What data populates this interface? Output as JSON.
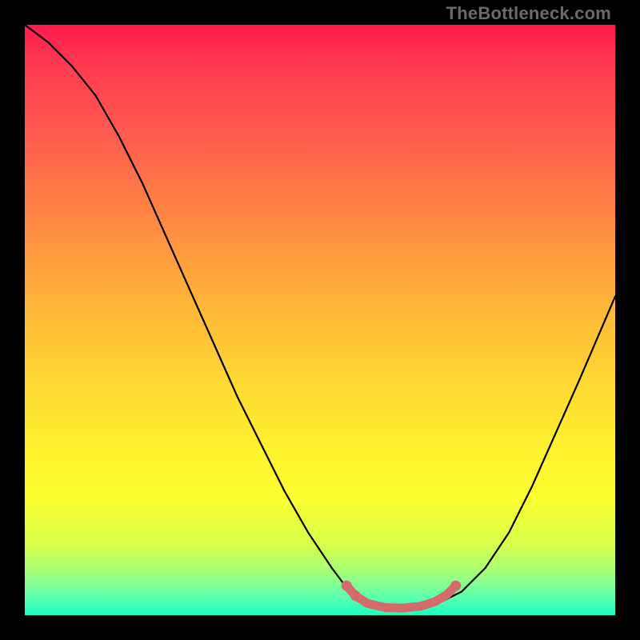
{
  "watermark": {
    "text": "TheBottleneck.com"
  },
  "colors": {
    "curve_stroke": "#000000",
    "highlight_stroke": "#d46a6a",
    "highlight_fill": "#d46a6a"
  },
  "chart_data": {
    "type": "line",
    "title": "",
    "xlabel": "",
    "ylabel": "",
    "xlim": [
      0,
      100
    ],
    "ylim": [
      0,
      100
    ],
    "grid": false,
    "series": [
      {
        "name": "bottleneck-curve",
        "x": [
          0,
          4,
          8,
          12,
          16,
          20,
          24,
          28,
          32,
          36,
          40,
          44,
          48,
          52,
          55,
          58,
          62,
          66,
          70,
          74,
          78,
          82,
          86,
          90,
          94,
          100
        ],
        "values": [
          100,
          97,
          93,
          88,
          81,
          73,
          64,
          55,
          46,
          37,
          29,
          21,
          14,
          8,
          4,
          2,
          1,
          1,
          2,
          4,
          8,
          14,
          22,
          31,
          40,
          54
        ]
      }
    ],
    "highlight": {
      "name": "optimal-range",
      "points": [
        {
          "x": 54.5,
          "y": 5.0
        },
        {
          "x": 56.0,
          "y": 3.3
        },
        {
          "x": 58.0,
          "y": 2.0
        },
        {
          "x": 61.0,
          "y": 1.3
        },
        {
          "x": 64.0,
          "y": 1.2
        },
        {
          "x": 67.0,
          "y": 1.5
        },
        {
          "x": 69.5,
          "y": 2.3
        },
        {
          "x": 71.5,
          "y": 3.5
        },
        {
          "x": 73.0,
          "y": 5.0
        }
      ],
      "dots": [
        {
          "x": 54.5,
          "y": 5.0
        },
        {
          "x": 56.0,
          "y": 3.3
        },
        {
          "x": 73.0,
          "y": 5.0
        }
      ]
    }
  }
}
